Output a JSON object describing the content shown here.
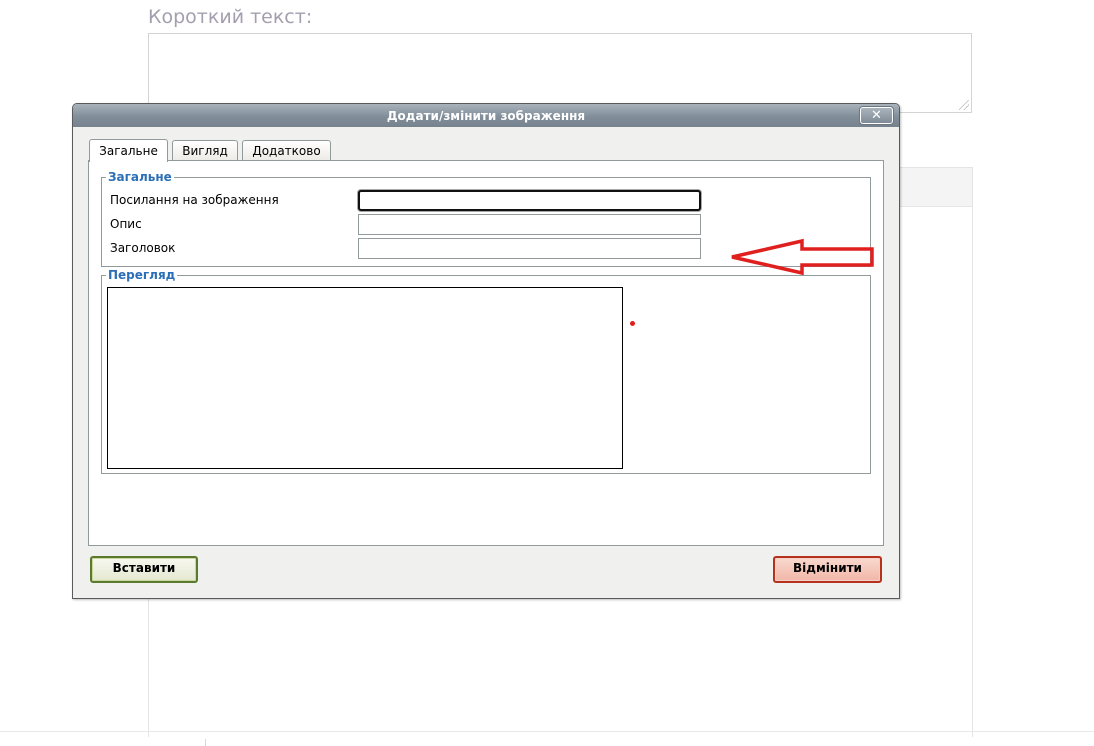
{
  "background": {
    "short_text_label": "Короткий текст:"
  },
  "dialog": {
    "title": "Додати/змінити зображення",
    "close_label": "✕",
    "tabs": [
      {
        "label": "Загальне",
        "active": true
      },
      {
        "label": "Вигляд",
        "active": false
      },
      {
        "label": "Додатково",
        "active": false
      }
    ],
    "general_section": {
      "legend": "Загальне",
      "fields": [
        {
          "label": "Посилання на зображення",
          "value": "",
          "focused": true
        },
        {
          "label": "Опис",
          "value": ""
        },
        {
          "label": "Заголовок",
          "value": ""
        }
      ]
    },
    "preview_section": {
      "legend": "Перегляд"
    },
    "buttons": {
      "insert": "Вставити",
      "cancel": "Відмінити"
    }
  },
  "colors": {
    "legend": "#2b6fb6",
    "arrow": "#e0201f",
    "titlebar": "#818e99"
  }
}
